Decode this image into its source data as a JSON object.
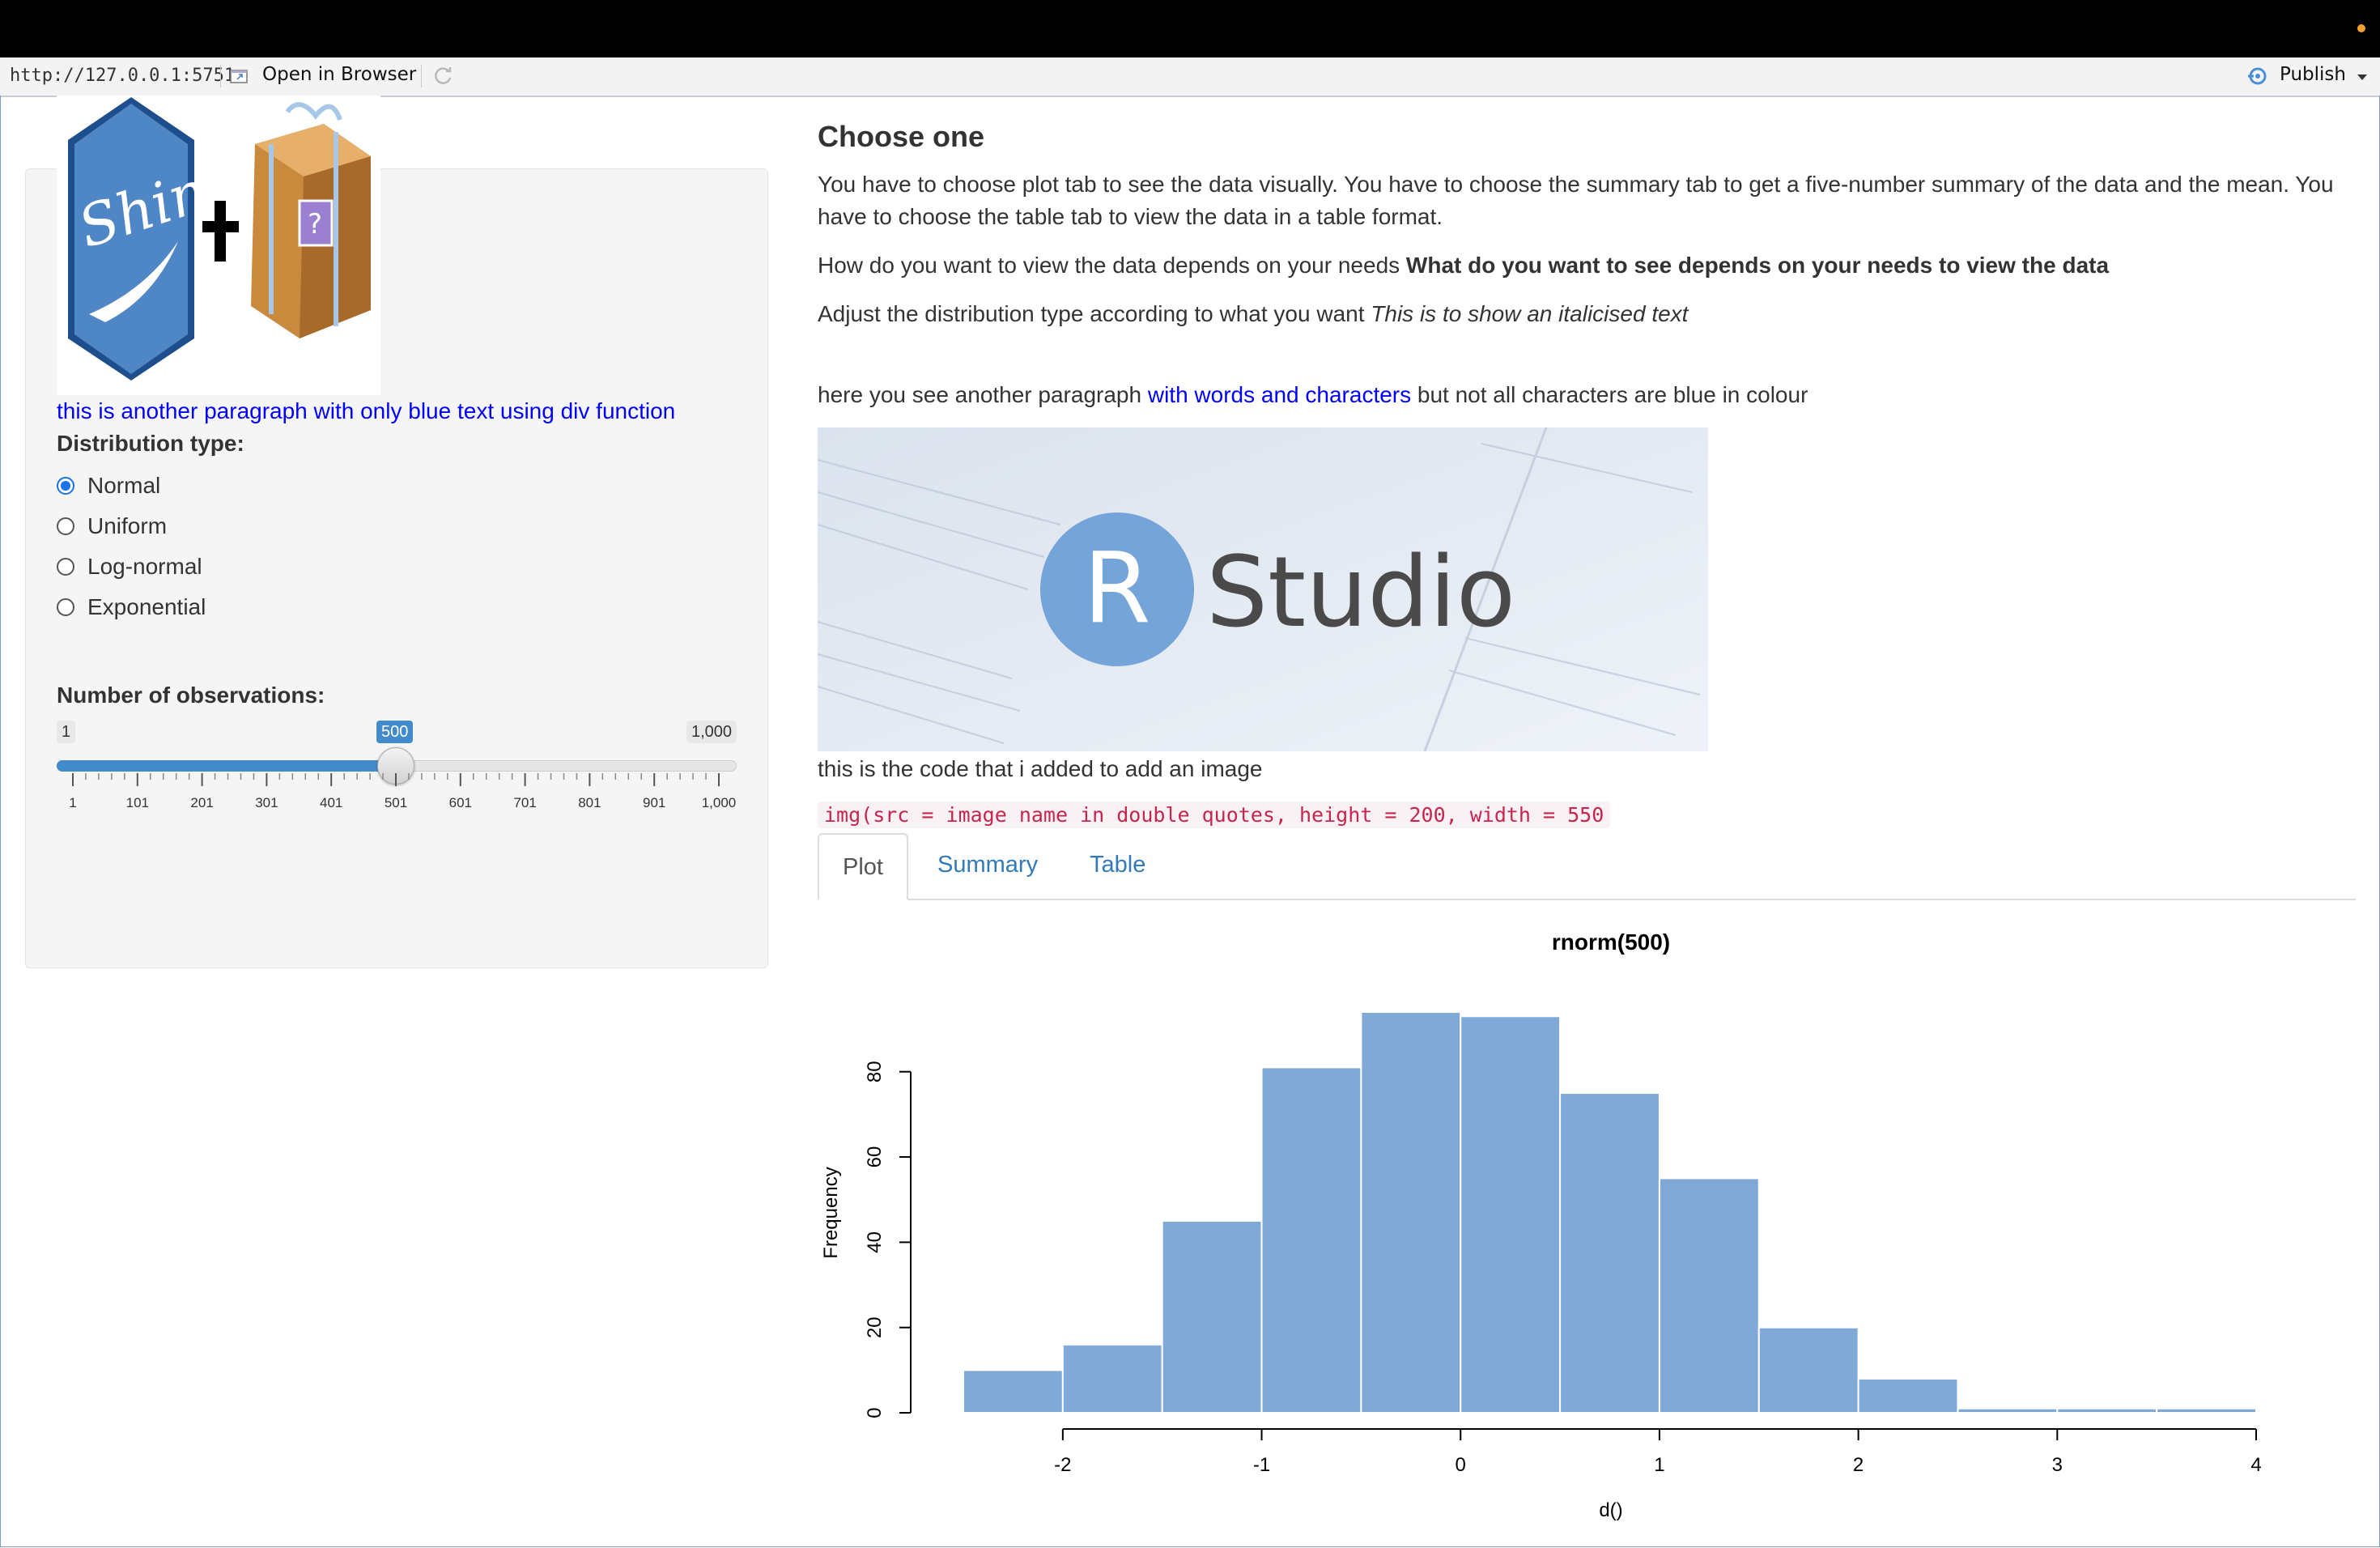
{
  "viewer": {
    "url": "http://127.0.0.1:5751",
    "open_browser_label": "Open in Browser",
    "publish_label": "Publish"
  },
  "sidebar": {
    "paragraph": "this is another paragraph with only blue text using div function",
    "dist_label": "Distribution type:",
    "radios": [
      {
        "label": "Normal",
        "selected": true
      },
      {
        "label": "Uniform",
        "selected": false
      },
      {
        "label": "Log-normal",
        "selected": false
      },
      {
        "label": "Exponential",
        "selected": false
      }
    ],
    "obs_label": "Number of observations:",
    "slider": {
      "min_label": "1",
      "max_label": "1,000",
      "value_label": "500",
      "value": 500,
      "min": 1,
      "max": 1000,
      "ticks": [
        "1",
        "101",
        "201",
        "301",
        "401",
        "501",
        "601",
        "701",
        "801",
        "901",
        "1,000"
      ]
    }
  },
  "main": {
    "title": "Choose one",
    "p1": "You have to choose plot tab to see the data visually. You have to choose the summary tab to get a five-number summary of the data and the mean. You have to choose the table tab to view the data in a table format.",
    "p2_plain": "How do you want to view the data depends on your needs ",
    "p2_bold": "What do you want to see depends on your needs to view the data",
    "p3_plain": "Adjust the distribution type according to what you want ",
    "p3_italic": "This is to show an italicised text",
    "p4_a": "here you see another paragraph ",
    "p4_blue": "with words and characters",
    "p4_b": " but not all characters are blue in colour",
    "rstudio_r": "R",
    "rstudio_text": "Studio",
    "img_caption": "this is the code that i added to add an image",
    "code": "img(src = image name in double quotes, height = 200, width = 550",
    "tabs": [
      "Plot",
      "Summary",
      "Table"
    ]
  },
  "colors": {
    "accent": "#428bca",
    "link": "#337ab7",
    "bar_fill": "#80a9d8",
    "blue_text": "#0000ff"
  },
  "chart_data": {
    "type": "bar",
    "title": "rnorm(500)",
    "xlabel": "d()",
    "ylabel": "Frequency",
    "bins": [
      -2.5,
      -2,
      -1.5,
      -1,
      -0.5,
      0,
      0.5,
      1,
      1.5,
      2,
      2.5,
      3,
      3.5,
      4
    ],
    "values": [
      10,
      16,
      45,
      81,
      94,
      93,
      75,
      55,
      20,
      8,
      1,
      1,
      1
    ],
    "xticks": [
      -2,
      -1,
      0,
      1,
      2,
      3,
      4
    ],
    "yticks": [
      0,
      20,
      40,
      60,
      80
    ],
    "xlim": [
      -2.5,
      4
    ],
    "ylim": [
      0,
      94
    ]
  }
}
